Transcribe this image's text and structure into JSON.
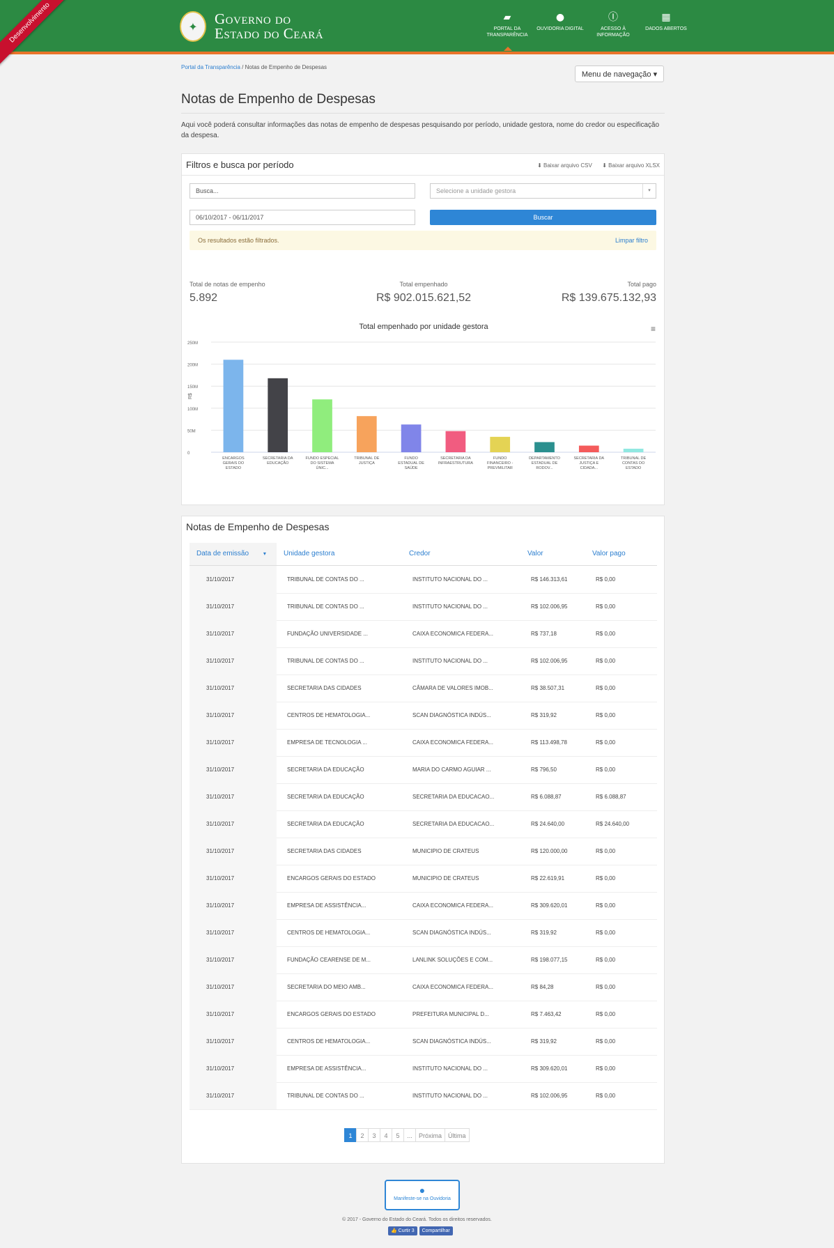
{
  "ribbon": "Desenvolvimento",
  "brand": {
    "line1": "Governo do",
    "line2": "Estado do Ceará",
    "seal_glyph": "✦"
  },
  "topnav": [
    {
      "icon": "folder-open-icon",
      "glyph": "▰",
      "label": "Portal da Transparência"
    },
    {
      "icon": "speech-bubble-icon",
      "glyph": "●",
      "label": "Ouvidoria Digital"
    },
    {
      "icon": "info-icon",
      "glyph": "ⓘ",
      "label": "Acesso à Informação"
    },
    {
      "icon": "table-icon",
      "glyph": "▦",
      "label": "Dados Abertos"
    }
  ],
  "breadcrumb": {
    "home": "Portal da Transparência",
    "sep": "/",
    "current": "Notas de Empenho de Despesas"
  },
  "menu_button": "Menu de navegação ▾",
  "page_title": "Notas de Empenho de Despesas",
  "intro": "Aqui você poderá consultar informações das notas de empenho de despesas pesquisando por período, unidade gestora, nome do credor ou especificação da despesa.",
  "filters": {
    "title": "Filtros e busca por período",
    "csv": "⬇ Baixar arquivo CSV",
    "xlsx": "⬇ Baixar arquivo XLSX",
    "search_placeholder": "Busca...",
    "unit_placeholder": "Selecione a unidade gestora",
    "unit_arrow": "▾",
    "date_range": "06/10/2017 - 06/11/2017",
    "search_button": "Buscar",
    "alert": "Os resultados estão filtrados.",
    "clear": "Limpar filtro"
  },
  "stats": {
    "count_label": "Total de notas de empenho",
    "count": "5.892",
    "empenhado_label": "Total empenhado",
    "empenhado": "R$ 902.015.621,52",
    "pago_label": "Total pago",
    "pago": "R$ 139.675.132,93"
  },
  "chart_menu": "≡",
  "chart_data": {
    "type": "bar",
    "title": "Total empenhado por unidade gestora",
    "ylabel": "R$",
    "yticks": [
      "0",
      "50M",
      "100M",
      "150M",
      "200M",
      "250M"
    ],
    "ylim": [
      0,
      250
    ],
    "categories": [
      [
        "ENCARGOS",
        "GERAIS DO",
        "ESTADO"
      ],
      [
        "SECRETARIA DA",
        "EDUCAÇÃO"
      ],
      [
        "FUNDO ESPECIAL",
        "DO SISTEMA",
        "ÚNIC..."
      ],
      [
        "TRIBUNAL DE",
        "JUSTIÇA"
      ],
      [
        "FUNDO",
        "ESTADUAL DE",
        "SAÚDE"
      ],
      [
        "SECRETARIA DA",
        "INFRAESTRUTURA"
      ],
      [
        "FUNDO",
        "FINANCEIRO -",
        "PREVMILITAR"
      ],
      [
        "DEPARTAMENTO",
        "ESTADUAL DE",
        "RODOV..."
      ],
      [
        "SECRETARIA DA",
        "JUSTIÇA E",
        "CIDADA..."
      ],
      [
        "TRIBUNAL DE",
        "CONTAS DO",
        "ESTADO"
      ]
    ],
    "values": [
      210,
      168,
      120,
      82,
      63,
      48,
      35,
      23,
      15,
      8
    ],
    "colors": [
      "#7cb5ec",
      "#434348",
      "#90ed7d",
      "#f7a35c",
      "#8085e9",
      "#f15c80",
      "#e4d354",
      "#2b908f",
      "#f45b5b",
      "#91e8e1"
    ],
    "grid": true
  },
  "table": {
    "title": "Notas de Empenho de Despesas",
    "headers": [
      "Data de emissão",
      "Unidade gestora",
      "Credor",
      "Valor",
      "Valor pago"
    ],
    "sort_icon": "▾",
    "rows": [
      [
        "31/10/2017",
        "TRIBUNAL DE CONTAS DO ...",
        "INSTITUTO NACIONAL DO ...",
        "R$ 146.313,61",
        "R$ 0,00"
      ],
      [
        "31/10/2017",
        "TRIBUNAL DE CONTAS DO ...",
        "INSTITUTO NACIONAL DO ...",
        "R$ 102.006,95",
        "R$ 0,00"
      ],
      [
        "31/10/2017",
        "FUNDAÇÃO UNIVERSIDADE ...",
        "CAIXA ECONOMICA FEDERA...",
        "R$ 737,18",
        "R$ 0,00"
      ],
      [
        "31/10/2017",
        "TRIBUNAL DE CONTAS DO ...",
        "INSTITUTO NACIONAL DO ...",
        "R$ 102.006,95",
        "R$ 0,00"
      ],
      [
        "31/10/2017",
        "SECRETARIA DAS CIDADES",
        "CÂMARA DE VALORES IMOB...",
        "R$ 38.507,31",
        "R$ 0,00"
      ],
      [
        "31/10/2017",
        "CENTROS DE HEMATOLOGIA...",
        "SCAN DIAGNÓSTICA INDÚS...",
        "R$ 319,92",
        "R$ 0,00"
      ],
      [
        "31/10/2017",
        "EMPRESA DE TECNOLOGIA ...",
        "CAIXA ECONOMICA FEDERA...",
        "R$ 113.498,78",
        "R$ 0,00"
      ],
      [
        "31/10/2017",
        "SECRETARIA DA EDUCAÇÃO",
        "MARIA DO CARMO AGUIAR ...",
        "R$ 796,50",
        "R$ 0,00"
      ],
      [
        "31/10/2017",
        "SECRETARIA DA EDUCAÇÃO",
        "SECRETARIA DA EDUCACAO...",
        "R$ 6.088,87",
        "R$ 6.088,87"
      ],
      [
        "31/10/2017",
        "SECRETARIA DA EDUCAÇÃO",
        "SECRETARIA DA EDUCACAO...",
        "R$ 24.640,00",
        "R$ 24.640,00"
      ],
      [
        "31/10/2017",
        "SECRETARIA DAS CIDADES",
        "MUNICIPIO DE CRATEUS",
        "R$ 120.000,00",
        "R$ 0,00"
      ],
      [
        "31/10/2017",
        "ENCARGOS GERAIS DO ESTADO",
        "MUNICIPIO DE CRATEUS",
        "R$ 22.619,91",
        "R$ 0,00"
      ],
      [
        "31/10/2017",
        "EMPRESA DE ASSISTÊNCIA...",
        "CAIXA ECONOMICA FEDERA...",
        "R$ 309.620,01",
        "R$ 0,00"
      ],
      [
        "31/10/2017",
        "CENTROS DE HEMATOLOGIA...",
        "SCAN DIAGNÓSTICA INDÚS...",
        "R$ 319,92",
        "R$ 0,00"
      ],
      [
        "31/10/2017",
        "FUNDAÇÃO CEARENSE DE M...",
        "LANLINK SOLUÇÕES E COM...",
        "R$ 198.077,15",
        "R$ 0,00"
      ],
      [
        "31/10/2017",
        "SECRETARIA DO MEIO AMB...",
        "CAIXA ECONOMICA FEDERA...",
        "R$ 84,28",
        "R$ 0,00"
      ],
      [
        "31/10/2017",
        "ENCARGOS GERAIS DO ESTADO",
        "PREFEITURA MUNICIPAL D...",
        "R$ 7.463,42",
        "R$ 0,00"
      ],
      [
        "31/10/2017",
        "CENTROS DE HEMATOLOGIA...",
        "SCAN DIAGNÓSTICA INDÚS...",
        "R$ 319,92",
        "R$ 0,00"
      ],
      [
        "31/10/2017",
        "EMPRESA DE ASSISTÊNCIA...",
        "INSTITUTO NACIONAL DO ...",
        "R$ 309.620,01",
        "R$ 0,00"
      ],
      [
        "31/10/2017",
        "TRIBUNAL DE CONTAS DO ...",
        "INSTITUTO NACIONAL DO ...",
        "R$ 102.006,95",
        "R$ 0,00"
      ]
    ],
    "pagination": [
      "1",
      "2",
      "3",
      "4",
      "5",
      "...",
      "Próxima",
      "Última"
    ],
    "current_page": "1"
  },
  "footer": {
    "ouvidoria": "Manifeste-se na Ouvidoria",
    "copyright": "© 2017 - Governo do Estado do Ceará. Todos os direitos reservados.",
    "like": "👍 Curtir 3",
    "share": "Compartilhar"
  }
}
